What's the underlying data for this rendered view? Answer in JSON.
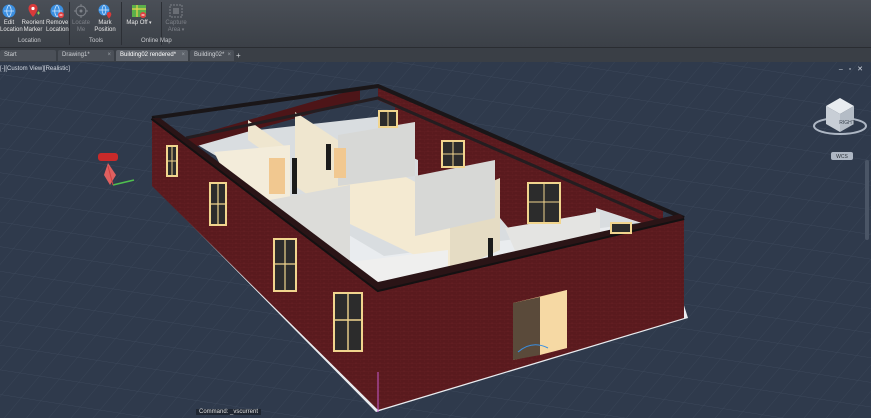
{
  "ribbon": {
    "buttons": [
      {
        "label1": "Edit",
        "label2": "Location",
        "icon": "globe-edit-icon"
      },
      {
        "label1": "Reorient",
        "label2": "Marker",
        "icon": "marker-icon"
      },
      {
        "label1": "Remove",
        "label2": "Location",
        "icon": "globe-remove-icon"
      },
      {
        "label1": "Locate",
        "label2": "Me",
        "icon": "locate-me-icon"
      },
      {
        "label1": "Mark",
        "label2": "Position",
        "icon": "mark-position-icon"
      },
      {
        "label1": "Map Off",
        "label2": "",
        "icon": "map-off-icon"
      },
      {
        "label1": "Capture",
        "label2": "Area",
        "icon": "capture-area-icon"
      }
    ],
    "groups": {
      "location": "Location",
      "tools": "Tools",
      "online_map": "Online Map"
    }
  },
  "tabs": [
    {
      "label": "Start"
    },
    {
      "label": "Drawing1*"
    },
    {
      "label": "Building02 rendered*"
    },
    {
      "label": "Building02*"
    }
  ],
  "viewport": {
    "label": "[-][Custom View][Realistic]",
    "controls": "–  ▫  ✕",
    "viewcube_label": "RIGHT",
    "wcs_label": "WCS"
  },
  "command": {
    "text": "Command: _vscurrent"
  },
  "colors": {
    "ribbon": "#3f444b",
    "viewport": "#2f3a4c",
    "grid": "#3b4658",
    "brick": "#5a1a1e",
    "wall_cream": "#efe6cf",
    "floor": "#d9dde0"
  }
}
